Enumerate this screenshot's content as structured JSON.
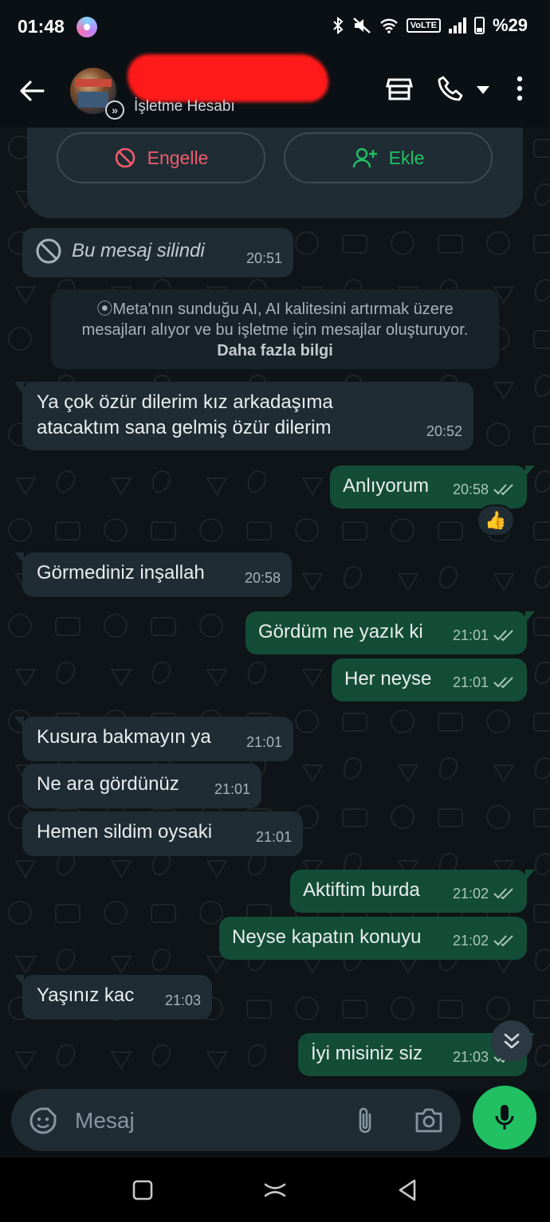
{
  "status_bar": {
    "time": "01:48",
    "volte": "VoLTE",
    "battery": "%29"
  },
  "header": {
    "subtitle": "İşletme Hesabı"
  },
  "actions": {
    "block_label": "Engelle",
    "add_label": "Ekle"
  },
  "deleted_message": {
    "text": "Bu mesaj silindi",
    "time": "20:51"
  },
  "notice": {
    "text": "Meta'nın sunduğu AI, AI kalitesini artırmak üzere mesajları alıyor ve bu işletme için mesajlar oluşturuyor.",
    "link": "Daha fazla bilgi"
  },
  "messages": [
    {
      "dir": "in",
      "text": "Ya çok özür dilerim kız arkadaşıma atacaktım sana gelmiş özür dilerim",
      "time": "20:52"
    },
    {
      "dir": "out",
      "text": "Anlıyorum",
      "time": "20:58",
      "reaction": "👍"
    },
    {
      "dir": "in",
      "text": "Görmediniz inşallah",
      "time": "20:58"
    },
    {
      "dir": "out",
      "text": "Gördüm ne yazık ki",
      "time": "21:01"
    },
    {
      "dir": "out",
      "text": "Her neyse",
      "time": "21:01"
    },
    {
      "dir": "in",
      "text": "Kusura bakmayın ya",
      "time": "21:01"
    },
    {
      "dir": "in",
      "text": "Ne ara gördünüz",
      "time": "21:01"
    },
    {
      "dir": "in",
      "text": "Hemen sildim oysaki",
      "time": "21:01"
    },
    {
      "dir": "out",
      "text": "Aktiftim burda",
      "time": "21:02"
    },
    {
      "dir": "out",
      "text": "Neyse kapatın konuyu",
      "time": "21:02"
    },
    {
      "dir": "in",
      "text": "Yaşınız kac",
      "time": "21:03"
    },
    {
      "dir": "out",
      "text": "İyi misiniz siz",
      "time": "21:03"
    }
  ],
  "composer": {
    "placeholder": "Mesaj"
  },
  "colors": {
    "accent": "#21c063",
    "outgoing_bubble": "#144d37",
    "incoming_bubble": "#1f2c34",
    "danger": "#f15c6d"
  }
}
